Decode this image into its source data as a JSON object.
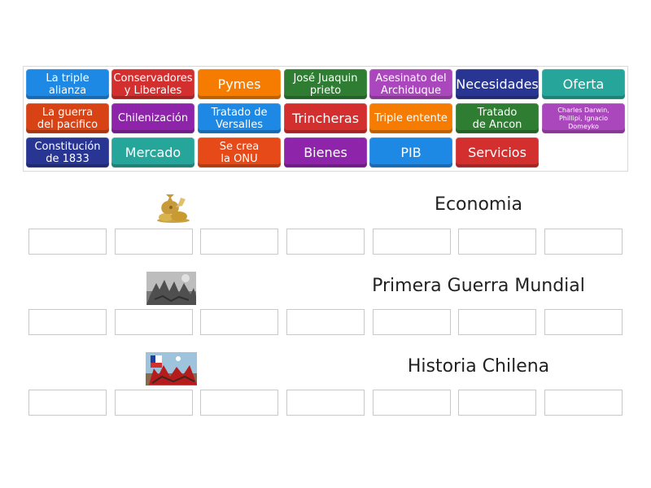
{
  "colors": {
    "blue": "#1e88e5",
    "red": "#d32f2f",
    "orange": "#f57c00",
    "green": "#2e7d32",
    "purple": "#8e24aa",
    "navy": "#283593",
    "teal": "#26a69a",
    "magenta": "#ab47bc"
  },
  "tiles": [
    {
      "label": "La triple\nalianza",
      "color": "#1e88e5"
    },
    {
      "label": "Conservadores\ny Liberales",
      "color": "#d32f2f"
    },
    {
      "label": "Pymes",
      "color": "#f57c00"
    },
    {
      "label": "José Juaquin\nprieto",
      "color": "#2e7d32"
    },
    {
      "label": "Asesinato del\nArchiduque",
      "color": "#ab47bc"
    },
    {
      "label": "Necesidades",
      "color": "#283593"
    },
    {
      "label": "Oferta",
      "color": "#26a69a"
    },
    {
      "label": "La guerra\ndel pacifico",
      "color": "#d84315"
    },
    {
      "label": "Chilenización",
      "color": "#8e24aa"
    },
    {
      "label": "Tratado de\nVersalles",
      "color": "#1e88e5"
    },
    {
      "label": "Trincheras",
      "color": "#d32f2f"
    },
    {
      "label": "Triple entente",
      "color": "#f57c00"
    },
    {
      "label": "Tratado\nde Ancon",
      "color": "#2e7d32"
    },
    {
      "label": "Charles Darwin,\nPhillipi, Ignacio\nDomeyko",
      "color": "#ab47bc"
    },
    {
      "label": "Constitución\nde 1833",
      "color": "#283593"
    },
    {
      "label": "Mercado",
      "color": "#26a69a"
    },
    {
      "label": "Se crea\nla ONU",
      "color": "#e64a19"
    },
    {
      "label": "Bienes",
      "color": "#8e24aa"
    },
    {
      "label": "PIB",
      "color": "#1e88e5"
    },
    {
      "label": "Servicios",
      "color": "#d32f2f"
    }
  ],
  "categories": [
    {
      "title": "Economia",
      "icon": "money-bags-icon"
    },
    {
      "title": "Primera Guerra Mundial",
      "icon": "battle-image"
    },
    {
      "title": "Historia Chilena",
      "icon": "chilean-battle-image"
    }
  ]
}
